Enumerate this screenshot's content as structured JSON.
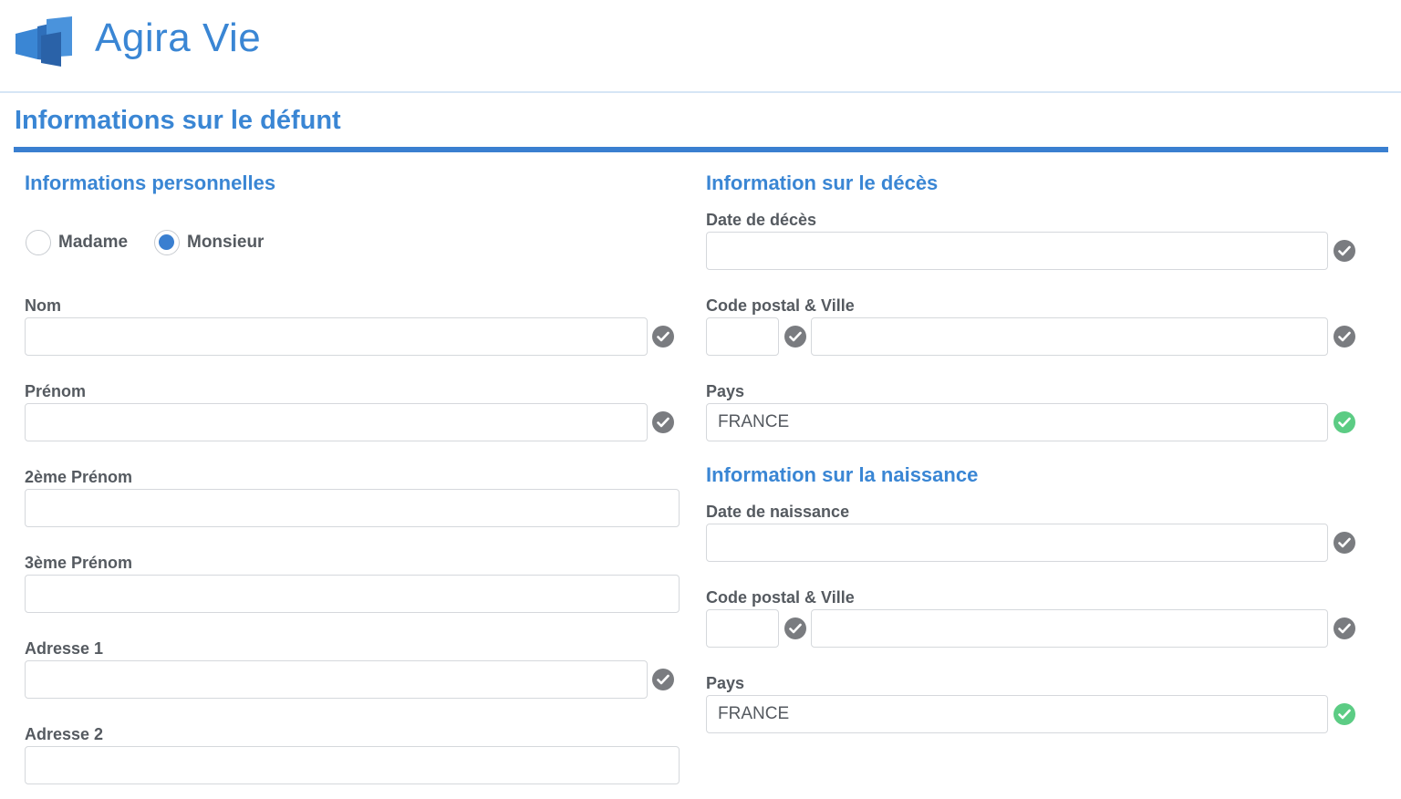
{
  "app": {
    "title": "Agira Vie",
    "accent": "#3a86d4",
    "valid_color": "#5ccc84"
  },
  "section": {
    "title": "Informations sur le défunt"
  },
  "personal": {
    "heading": "Informations personnelles",
    "civility": {
      "options": [
        "Madame",
        "Monsieur"
      ],
      "selected": "Monsieur"
    },
    "nom_label": "Nom",
    "prenom_label": "Prénom",
    "prenom2_label": "2ème Prénom",
    "prenom3_label": "3ème Prénom",
    "adresse1_label": "Adresse 1",
    "adresse2_label": "Adresse 2"
  },
  "death": {
    "heading": "Information sur le décès",
    "date_label": "Date de décès",
    "cp_ville_label": "Code postal & Ville",
    "pays_label": "Pays",
    "pays_value": "FRANCE"
  },
  "birth": {
    "heading": "Information sur la naissance",
    "date_label": "Date de naissance",
    "cp_ville_label": "Code postal & Ville",
    "pays_label": "Pays",
    "pays_value": "FRANCE"
  }
}
